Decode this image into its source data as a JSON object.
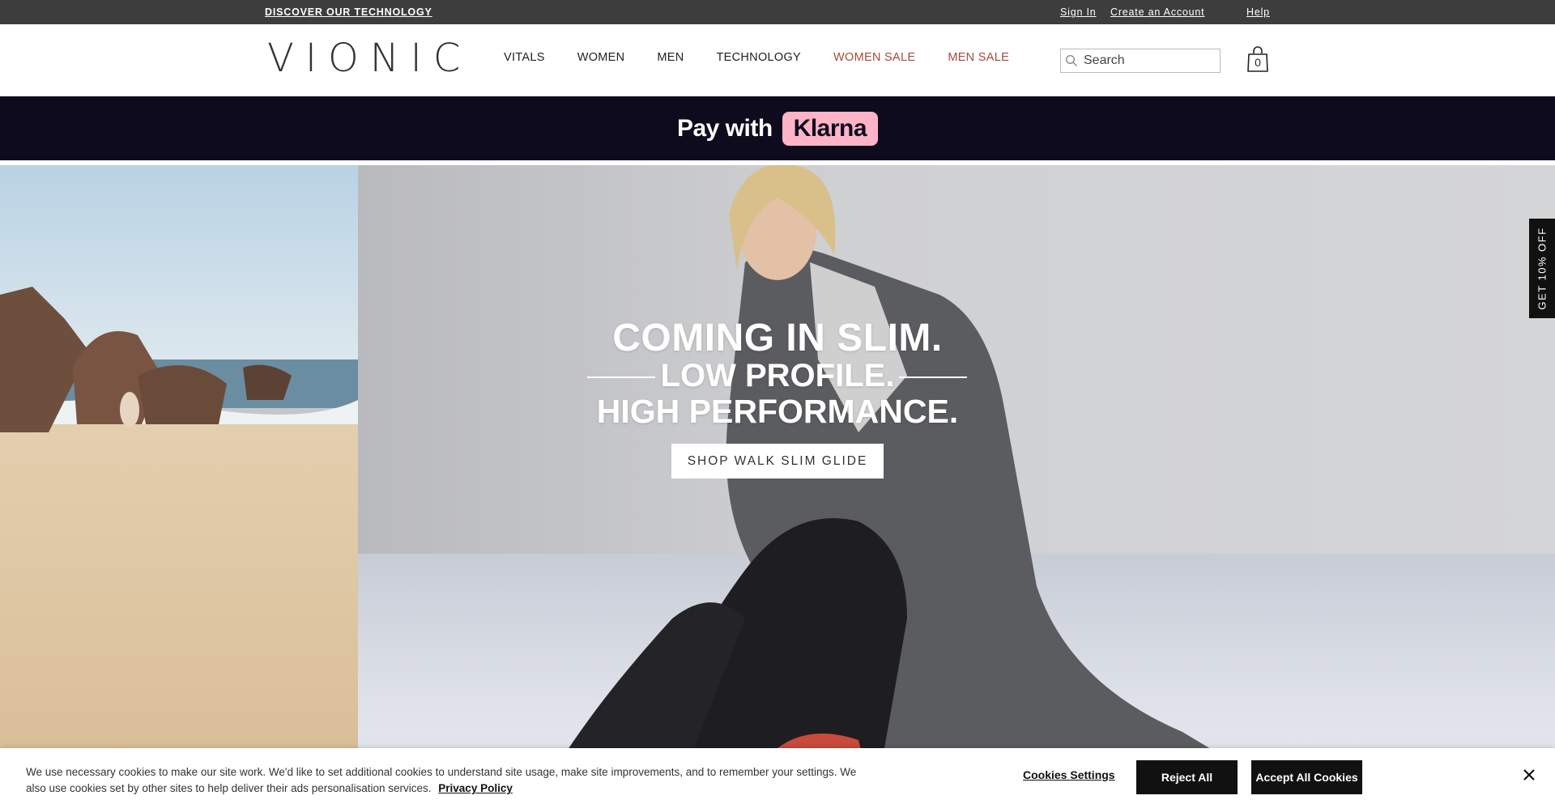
{
  "utility_bar": {
    "discover": "DISCOVER OUR TECHNOLOGY",
    "sign_in": "Sign In",
    "create_account": "Create an Account",
    "help": "Help"
  },
  "header": {
    "logo": "VIONIC",
    "nav": [
      "VITALS",
      "WOMEN",
      "MEN",
      "TECHNOLOGY",
      "WOMEN SALE",
      "MEN SALE"
    ],
    "search_placeholder": "Search",
    "cart_count": "0",
    "sale_color": "#a54a3a"
  },
  "klarna_banner": {
    "text": "Pay with",
    "brand": "Klarna"
  },
  "hero": {
    "line1": "COMING IN SLIM.",
    "line2": "LOW PROFILE.",
    "line3": "HIGH PERFORMANCE.",
    "cta": "SHOP WALK SLIM GLIDE"
  },
  "side_tab": {
    "label": "GET 10% OFF"
  },
  "cookie_banner": {
    "text": "We use necessary cookies to make our site work. We'd like to set additional cookies to understand site usage, make site improvements, and to remember your settings. We also use cookies set by other sites to help deliver their ads personalisation services.",
    "privacy_link": "Privacy Policy",
    "settings": "Cookies Settings",
    "reject": "Reject All",
    "accept": "Accept All Cookies"
  }
}
